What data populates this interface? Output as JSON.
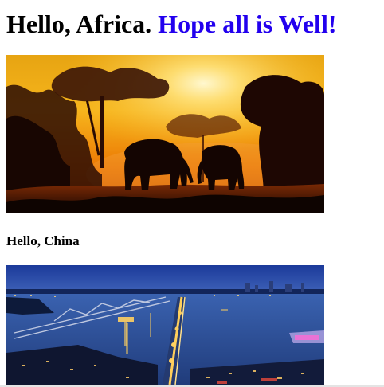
{
  "page": {
    "heading_main": "Hello, Africa.",
    "heading_accent": "Hope all is Well!",
    "subheading": "Hello, China"
  },
  "images": {
    "africa": {
      "subject": "elephants-at-sunset-savanna",
      "colors": {
        "sky_top": "#f7b21a",
        "sky_mid": "#f08a05",
        "horizon": "#d45a00",
        "ground": "#1a0803"
      }
    },
    "china": {
      "subject": "bridges-over-river-city-night",
      "colors": {
        "sky": "#1f3a8c",
        "water": "#2c4f9a",
        "lights": "#ffcf5a"
      }
    }
  },
  "colors": {
    "accent": "#2200ee",
    "text": "#000000"
  }
}
